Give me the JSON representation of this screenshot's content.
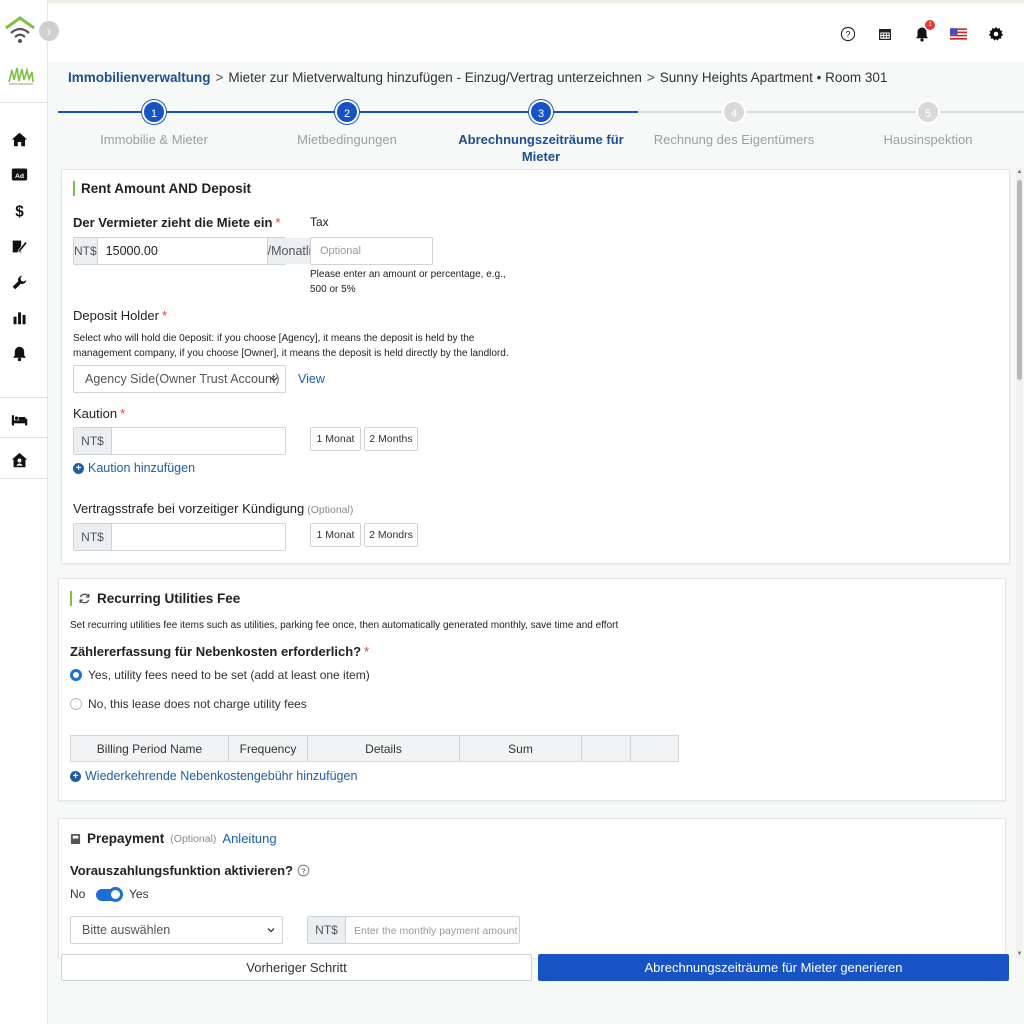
{
  "breadcrumb": {
    "items": [
      "Immobilienverwaltung",
      "Mieter zur Mietverwaltung hinzufügen - Einzug/Vertrag unterzeichnen",
      "Sunny Heights Apartment • Room 301"
    ],
    "separator": ">"
  },
  "stepper": {
    "steps": [
      {
        "num": "1",
        "label": "Immobilie & Mieter"
      },
      {
        "num": "2",
        "label": "Mietbedingungen"
      },
      {
        "num": "3",
        "label": "Abrechnungszeiträume für Mieter"
      },
      {
        "num": "4",
        "label": "Rechnung des Eigentümers"
      },
      {
        "num": "5",
        "label": "Hausinspektion"
      }
    ],
    "current": 3
  },
  "rent": {
    "section_title": "Rent Amount AND Deposit",
    "landlord_label": "Der Vermieter zieht die Miete ein",
    "currency": "NT$",
    "rent_value": "15000.00",
    "rent_unit": "/Monatlich",
    "tax_label": "Tax",
    "tax_placeholder": "Optional",
    "tax_hint": "Please enter an amount or percentage, e.g., 500 or 5%",
    "deposit_holder_label": "Deposit Holder",
    "deposit_holder_hint": "Select who will hold die 0eposit: if you choose [Agency], it means the deposit is held by the management company, if you choose [Owner], it means the deposit is held directly by the landlord.",
    "deposit_holder_value": "Agency Side(Owner Trust Account)",
    "view_link": "View",
    "kaution_label": "Kaution",
    "chip_1": "1 Monat",
    "chip_2": "2 Months",
    "add_kaution": "Kaution hinzufügen",
    "penalty_label": "Vertragsstrafe bei vorzeitiger Kündigung",
    "penalty_optional": "(Optional)",
    "penalty_chip_1": "1 Monat",
    "penalty_chip_2": "2 Mondrs"
  },
  "utilities": {
    "section_title": "Recurring Utilities Fee",
    "description": "Set recurring utilities fee items such as utilities, parking fee once, then automatically generated monthly, save time and effort",
    "meter_label": "Zählererfassung für Nebenkosten erforderlich?",
    "option_yes": "Yes, utility fees need to be set (add at least one item)",
    "option_no": "No, this lease does not charge utility fees",
    "table_headers": [
      "Billing Period Name",
      "Frequency",
      "Details",
      "Sum",
      "",
      ""
    ],
    "add_link": "Wiederkehrende Nebenkostengebühr hinzufügen"
  },
  "prepayment": {
    "section_title": "Prepayment",
    "optional": "(Optional)",
    "guide_link": "Anleitung",
    "activate_label": "Vorauszahlungsfunktion aktivieren?",
    "toggle_no": "No",
    "toggle_yes": "Yes",
    "toggle_on": true,
    "select_placeholder": "Bitte auswählen",
    "currency": "NT$",
    "amount_placeholder": "Enter the monthly payment amount"
  },
  "footer": {
    "prev_label": "Vorheriger Schritt",
    "next_label": "Abrechnungszeiträume für Mieter generieren"
  },
  "topbar": {
    "notification_count": "1"
  },
  "colors": {
    "primary": "#1853c5",
    "link": "#1d5ea8",
    "accent_green": "#7cc242",
    "required": "#e53935"
  }
}
